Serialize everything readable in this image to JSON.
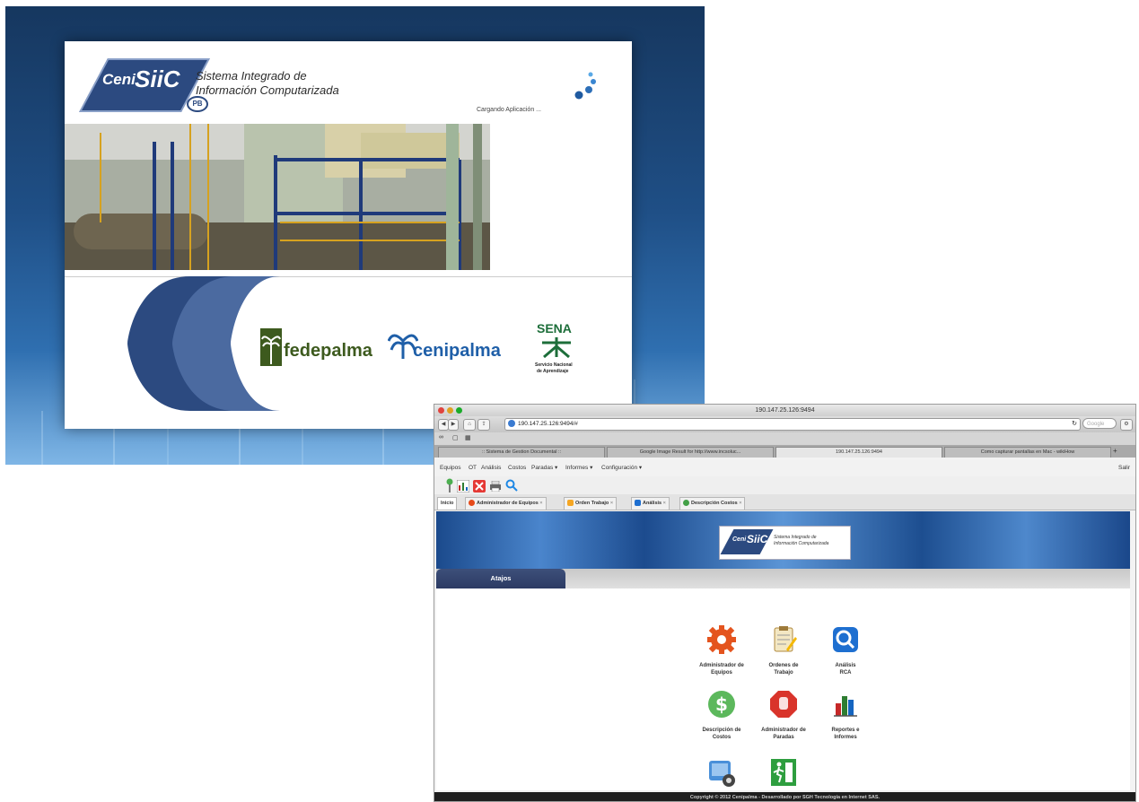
{
  "splash": {
    "logo": {
      "ceni": "Ceni",
      "siic": "SiiC",
      "pb": "PB",
      "subtitle_line1": "Sistema Integrado de",
      "subtitle_line2": "Información Computarizada"
    },
    "loading_text": "Cargando Aplicación ...",
    "partners": {
      "fedepalma": "fedepalma",
      "cenipalma": "cenipalma",
      "sena": "SENA",
      "sena_sub1": "Servicio Nacional",
      "sena_sub2": "de Aprendizaje"
    }
  },
  "browser": {
    "window_title": "190.147.25.126:9494",
    "url": "190.147.25.126:9494/#",
    "search_placeholder": "Google",
    "tabs": [
      {
        "label": ":: Sistema de Gestion Documental ::"
      },
      {
        "label": "Google Image Result for http://www.incsoluc..."
      },
      {
        "label": "190.147.25.126:9494"
      },
      {
        "label": "Como capturar pantallas en Mac - wikiHow"
      }
    ]
  },
  "app": {
    "menu": {
      "equipos": "Equipos",
      "ot": "OT",
      "analisis": "Análisis",
      "costos": "Costos",
      "paradas": "Paradas ▾",
      "informes": "Informes ▾",
      "configuracion": "Configuración ▾",
      "salir": "Salir"
    },
    "tabs": {
      "inicio": "Inicio",
      "admin_equipos": "Administrador de Equipos",
      "orden_trabajo": "Orden Trabajo",
      "analisis": "Análisis",
      "descripcion_costos": "Descripción Costos"
    },
    "banner": {
      "ceni": "Ceni",
      "siic": "SiiC",
      "subtitle_line1": "Sistema Integrado de",
      "subtitle_line2": "Información Computarizada"
    },
    "atajos_label": "Atajos",
    "shortcuts": [
      {
        "line1": "Administrador de",
        "line2": "Equipos"
      },
      {
        "line1": "Ordenes de",
        "line2": "Trabajo"
      },
      {
        "line1": "Análisis",
        "line2": "RCA"
      },
      {
        "line1": "Descripción de",
        "line2": "Costos"
      },
      {
        "line1": "Administrador de",
        "line2": "Paradas"
      },
      {
        "line1": "Reportes e",
        "line2": "Informes"
      }
    ],
    "footer": "Copyright © 2012 Cenipalma - Desarrollado por SGH Tecnología en Internet SAS."
  },
  "colors": {
    "brand_navy": "#2c4a80",
    "banner_blue": "#1b4a8c",
    "atajos_tab": "#2c3b63",
    "fedepalma_green": "#3d5a1e",
    "cenipalma_blue": "#1f5fa8"
  }
}
